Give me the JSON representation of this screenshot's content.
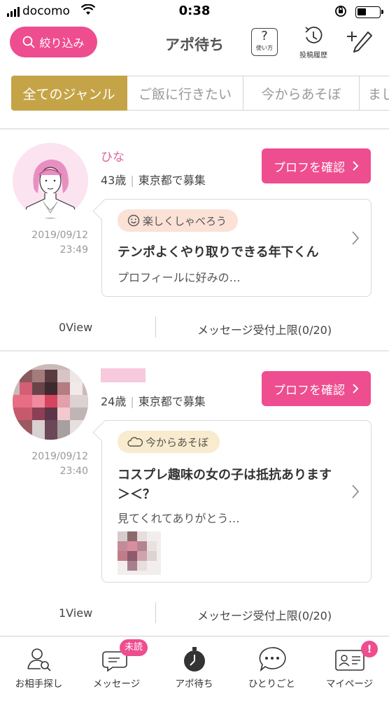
{
  "status_bar": {
    "carrier": "docomo",
    "time": "0:38"
  },
  "header": {
    "filter_label": "絞り込み",
    "title": "アポ待ち",
    "help_glyph": "?",
    "help_label": "使い方",
    "history_label": "投稿履歴"
  },
  "genre_tabs": [
    {
      "label": "全てのジャンル",
      "active": true
    },
    {
      "label": "ご飯に行きたい",
      "active": false
    },
    {
      "label": "今からあそぼ",
      "active": false
    },
    {
      "label": "まじ",
      "active": false
    }
  ],
  "posts": [
    {
      "name": "ひな",
      "age": "43歳",
      "location": "東京都で募集",
      "profile_button": "プロフを確認",
      "date": "2019/09/12",
      "time": "23:49",
      "tag": "楽しくしゃべろう",
      "tag_color": "#fbe1d6",
      "title": "テンポよくやり取りできる年下くん",
      "excerpt": "プロフィールに好みの…",
      "views": "0View",
      "message_limit": "メッセージ受付上限(0/20)"
    },
    {
      "name": "",
      "age": "24歳",
      "location": "東京都で募集",
      "profile_button": "プロフを確認",
      "date": "2019/09/12",
      "time": "23:40",
      "tag": "今からあそぼ",
      "tag_color": "#f9ebcd",
      "title": "コスプレ趣味の女の子は抵抗あります＞＜？",
      "excerpt": "見てくれてありがとう…",
      "views": "1View",
      "message_limit": "メッセージ受付上限(0/20)"
    }
  ],
  "bottom_nav": [
    {
      "label": "お相手探し",
      "icon": "search-person-icon"
    },
    {
      "label": "メッセージ",
      "icon": "message-bubble-icon",
      "badge": "未読"
    },
    {
      "label": "アポ待ち",
      "icon": "clock-icon"
    },
    {
      "label": "ひとりごと",
      "icon": "speech-bubble-icon"
    },
    {
      "label": "マイページ",
      "icon": "id-card-icon",
      "badge": "!"
    }
  ],
  "colors": {
    "accent_pink": "#ee4d8f",
    "genre_active": "#c5a448",
    "name_pink": "#e0679c"
  }
}
